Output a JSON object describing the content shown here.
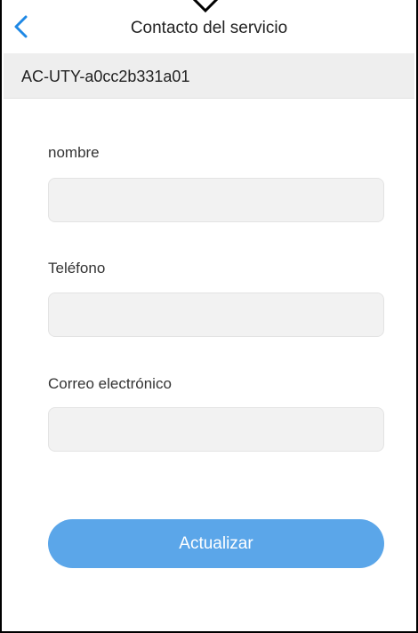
{
  "header": {
    "title": "Contacto del servicio",
    "back_icon": "chevron-left-icon"
  },
  "device": {
    "id": "AC-UTY-a0cc2b331a01"
  },
  "form": {
    "name_label": "nombre",
    "name_value": "",
    "phone_label": "Teléfono",
    "phone_value": "",
    "email_label": "Correo electrónico",
    "email_value": ""
  },
  "actions": {
    "update_label": "Actualizar"
  },
  "colors": {
    "accent": "#5ba6e9",
    "back_icon": "#1e88e5",
    "device_bar": "#eeeeee",
    "input_fill": "#f2f2f2"
  }
}
